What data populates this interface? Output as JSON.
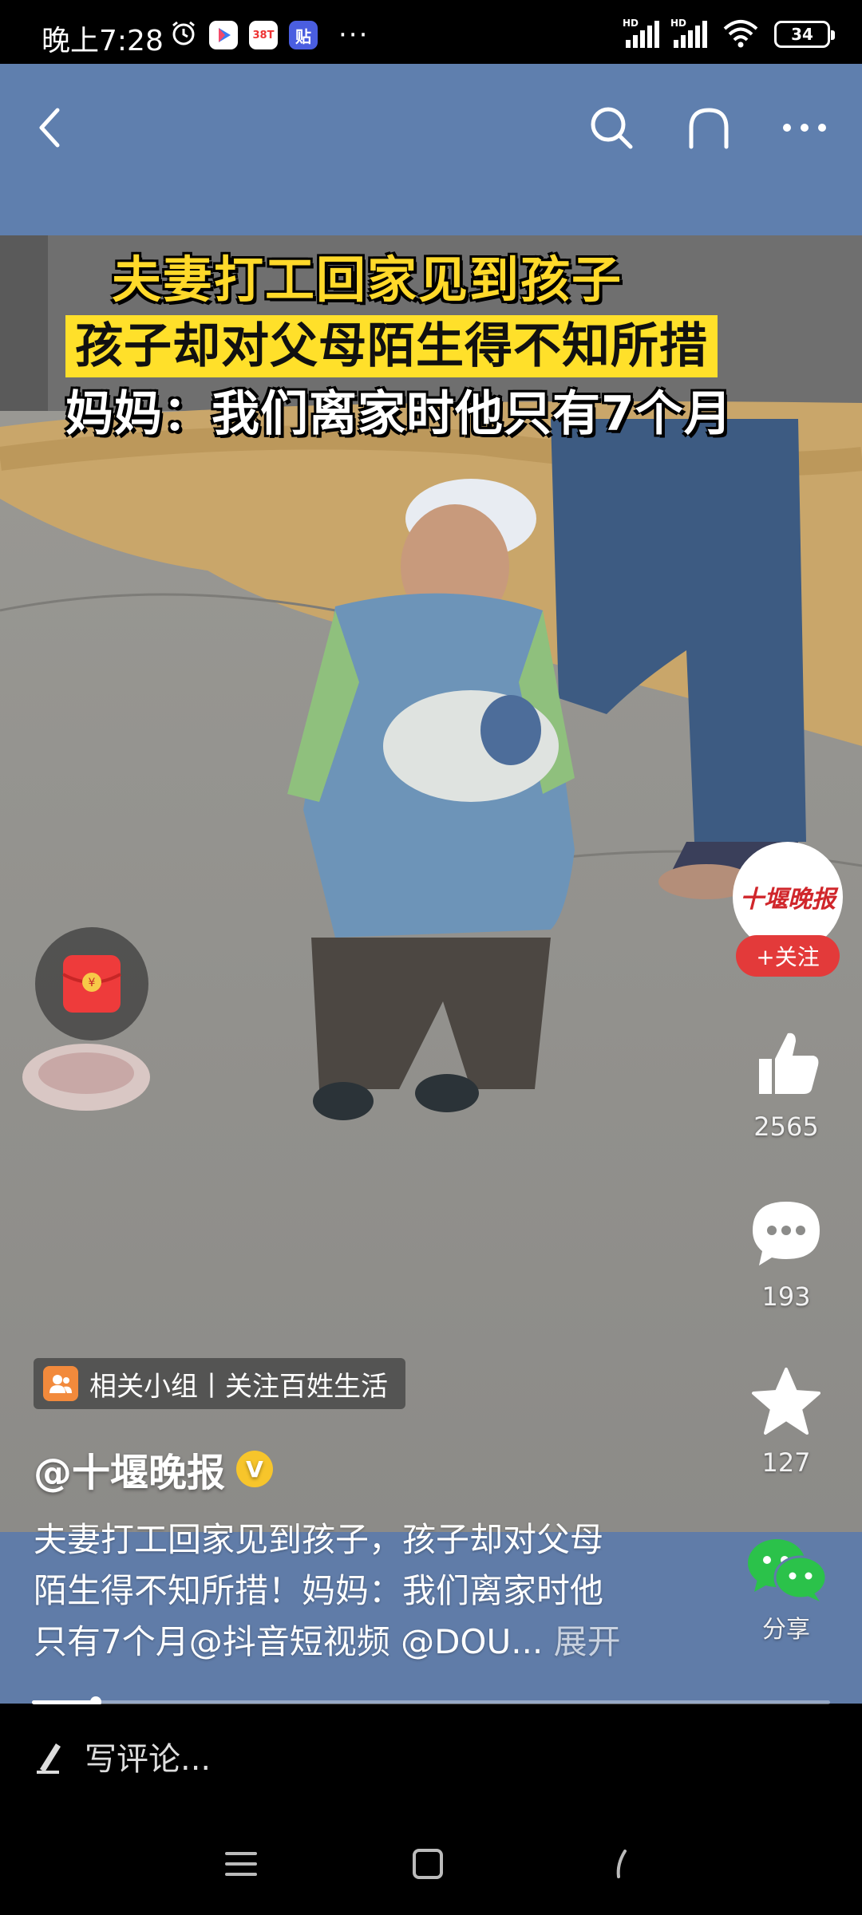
{
  "status_bar": {
    "time": "晚上7:28",
    "app_badge_1": "38T",
    "app_badge_2": "贴",
    "more": "···",
    "signal_1": "HD",
    "signal_2": "HD",
    "battery": "34"
  },
  "video": {
    "headline_1": "夫妻打工回家见到孩子",
    "headline_2": "孩子却对父母陌生得不知所措",
    "headline_3": "妈妈：我们离家时他只有7个月",
    "progress": 0.08
  },
  "rail": {
    "avatar_text": "十堰晚报",
    "follow_label": "+关注",
    "likes": "2565",
    "comments": "193",
    "favorites": "127",
    "share_label": "分享"
  },
  "post": {
    "group_tag": "相关小组丨关注百姓生活",
    "author": "@十堰晚报",
    "verified_badge": "V",
    "caption_line_1": "夫妻打工回家见到孩子，孩子却对父母",
    "caption_line_2": "陌生得不知所措！妈妈：我们离家时他",
    "caption_line_3": "只有7个月@抖音短视频 @DOU...",
    "expand_label": "展开"
  },
  "comment_bar": {
    "placeholder": "写评论..."
  },
  "colors": {
    "header_bg": "#5f7fae",
    "follow_red": "#e33a3a",
    "headline_yellow": "#ffd92a",
    "wechat_green": "#2bc24a"
  }
}
